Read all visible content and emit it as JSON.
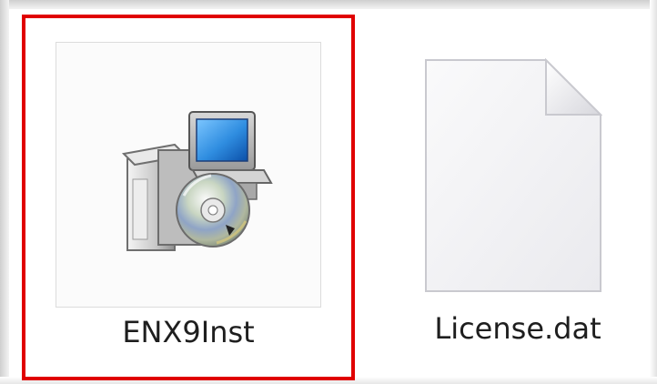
{
  "files": [
    {
      "name": "ENX9Inst",
      "icon": "installer-icon",
      "selected": true
    },
    {
      "name": "License.dat",
      "icon": "blank-document-icon",
      "selected": false
    }
  ],
  "colors": {
    "selection_outline": "#e00000",
    "document_fill": "#f1f1f3",
    "document_edge": "#c9c9cf",
    "monitor_screen": "#2f8de0"
  }
}
